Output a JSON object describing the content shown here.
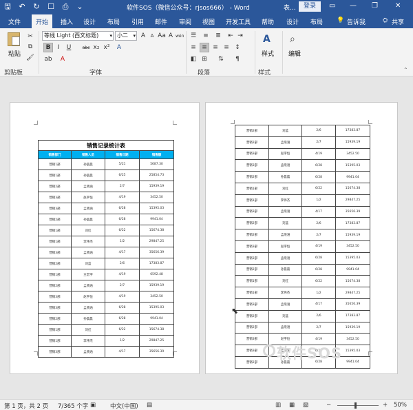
{
  "window": {
    "title": "软件SOS（微信公众号：rjsos666） - Word",
    "context_label": "表...",
    "login": "登录",
    "minimize": "—",
    "restore": "❐",
    "close": "✕"
  },
  "tabs": [
    "文件",
    "开始",
    "插入",
    "设计",
    "布局",
    "引用",
    "邮件",
    "审阅",
    "视图",
    "开发工具",
    "帮助",
    "设计",
    "布局"
  ],
  "tell_me": "告诉我",
  "share": "共享",
  "ribbon": {
    "paste": "粘贴",
    "clipboard_label": "剪贴板",
    "font_label": "字体",
    "paragraph_label": "段落",
    "styles_label": "样式",
    "styles_btn": "样式",
    "edit_btn": "编辑",
    "font_name": "等线 Light (西文标题)",
    "font_size": "小二",
    "bold": "B",
    "italic": "I",
    "underline": "U",
    "strike": "abc",
    "sub": "x₂",
    "sup": "x²",
    "grow": "A",
    "shrink": "A",
    "aa": "Aa",
    "clear": "A",
    "wen": "wén",
    "font_a": "A",
    "font_color_a": "A",
    "highlight": "ab"
  },
  "doc": {
    "table_title": "销售记录统计表",
    "headers": [
      "销售部门",
      "销售人员",
      "销售日期",
      "销售额"
    ],
    "page1_rows": [
      [
        "营销1部",
        "孙晨晨",
        "5/21",
        "5687.30"
      ],
      [
        "营销1部",
        "孙晨晨",
        "6/25",
        "25854.73"
      ],
      [
        "营销2部",
        "孟晓涵",
        "2/7",
        "15939.19"
      ],
      [
        "营销3部",
        "赵宇恒",
        "4/19",
        "3452.50"
      ],
      [
        "营销3部",
        "孟晓涵",
        "6/28",
        "15395.03"
      ],
      [
        "营销2部",
        "孙晨晨",
        "6/28",
        "9941.04"
      ],
      [
        "营销1部",
        "刘红",
        "6/22",
        "15674.38"
      ],
      [
        "营销1部",
        "李伟杰",
        "1/2",
        "29847.25"
      ],
      [
        "营销3部",
        "孟晓涵",
        "4/17",
        "35656.39"
      ],
      [
        "营销2部",
        "刘蓝",
        "2/6",
        "17383.87"
      ],
      [
        "营销1部",
        "王宏宇",
        "4/19",
        "6592.48"
      ],
      [
        "营销2部",
        "孟晓涵",
        "2/7",
        "15939.19"
      ],
      [
        "营销3部",
        "赵宇恒",
        "4/19",
        "3452.50"
      ],
      [
        "营销3部",
        "孟晓涵",
        "6/28",
        "15395.03"
      ],
      [
        "营销2部",
        "孙晨晨",
        "6/28",
        "9941.04"
      ],
      [
        "营销1部",
        "刘红",
        "6/22",
        "15674.38"
      ],
      [
        "营销1部",
        "李伟杰",
        "1/2",
        "29847.25"
      ],
      [
        "营销3部",
        "孟晓涵",
        "4/17",
        "35656.39"
      ]
    ],
    "page2_rows": [
      [
        "营销2部",
        "刘蓝",
        "2/6",
        "17383.87"
      ],
      [
        "营销2部",
        "孟晓涵",
        "2/7",
        "15939.19"
      ],
      [
        "营销3部",
        "赵宇恒",
        "4/19",
        "3452.50"
      ],
      [
        "营销3部",
        "孟晓涵",
        "6/28",
        "15395.03"
      ],
      [
        "营销2部",
        "孙晨晨",
        "6/28",
        "9941.04"
      ],
      [
        "营销1部",
        "刘红",
        "6/22",
        "15674.38"
      ],
      [
        "营销1部",
        "李伟杰",
        "1/2",
        "29847.25"
      ],
      [
        "营销3部",
        "孟晓涵",
        "4/17",
        "35656.39"
      ],
      [
        "营销2部",
        "刘蓝",
        "2/6",
        "17383.87"
      ],
      [
        "营销2部",
        "孟晓涵",
        "2/7",
        "15939.19"
      ],
      [
        "营销3部",
        "赵宇恒",
        "4/19",
        "3452.50"
      ],
      [
        "营销3部",
        "孟晓涵",
        "6/28",
        "15395.03"
      ],
      [
        "营销2部",
        "孙晨晨",
        "6/28",
        "9941.04"
      ],
      [
        "营销1部",
        "刘红",
        "6/22",
        "15674.38"
      ],
      [
        "营销1部",
        "李伟杰",
        "1/2",
        "29847.25"
      ],
      [
        "营销3部",
        "孟晓涵",
        "4/17",
        "35656.39"
      ],
      [
        "营销2部",
        "刘蓝",
        "2/6",
        "17383.87"
      ],
      [
        "营销2部",
        "孟晓涵",
        "2/7",
        "15939.19"
      ],
      [
        "营销3部",
        "赵宇恒",
        "4/19",
        "3452.50"
      ],
      [
        "营销3部",
        "孟晓涵",
        "6/28",
        "15395.03"
      ],
      [
        "营销2部",
        "孙晨晨",
        "6/28",
        "9941.04"
      ]
    ],
    "watermark": "软件SOS"
  },
  "status": {
    "page": "第 1 页，共 2 页",
    "words": "7/365 个字",
    "lang": "中文(中国)",
    "zoom": "50%",
    "zoom_fraction": 0.5
  }
}
